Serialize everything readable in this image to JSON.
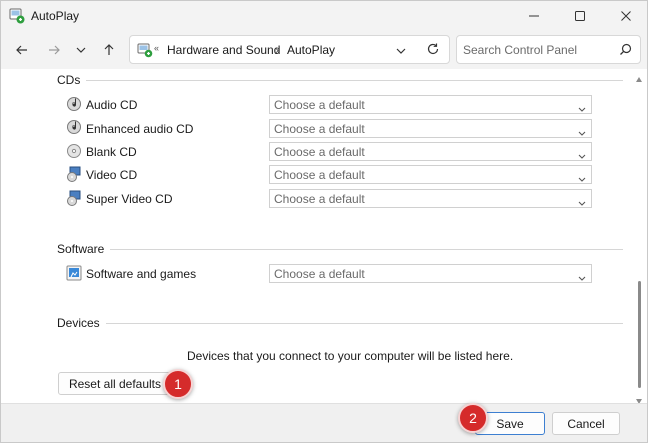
{
  "window": {
    "title": "AutoPlay"
  },
  "navigation": {
    "breadcrumb_root_sep": "«",
    "breadcrumb": [
      "Hardware and Sound",
      "AutoPlay"
    ],
    "breadcrumb_sep": "›",
    "search_placeholder": "Search Control Panel"
  },
  "sections": {
    "cds": {
      "label": "CDs",
      "items": [
        {
          "label": "Audio CD",
          "value": "Choose a default",
          "icon": "audio-cd-icon"
        },
        {
          "label": "Enhanced audio CD",
          "value": "Choose a default",
          "icon": "enhanced-audio-cd-icon"
        },
        {
          "label": "Blank CD",
          "value": "Choose a default",
          "icon": "blank-cd-icon"
        },
        {
          "label": "Video CD",
          "value": "Choose a default",
          "icon": "video-cd-icon"
        },
        {
          "label": "Super Video CD",
          "value": "Choose a default",
          "icon": "super-video-cd-icon"
        }
      ]
    },
    "software": {
      "label": "Software",
      "items": [
        {
          "label": "Software and games",
          "value": "Choose a default",
          "icon": "software-games-icon"
        }
      ]
    },
    "devices": {
      "label": "Devices",
      "info": "Devices that you connect to your computer will be listed here."
    }
  },
  "buttons": {
    "reset": "Reset all defaults",
    "save": "Save",
    "cancel": "Cancel"
  },
  "callouts": [
    "1",
    "2"
  ],
  "colors": {
    "callout": "#d52b2b",
    "primary_border": "#3d7fd1",
    "chrome": "#f3f3f3"
  }
}
